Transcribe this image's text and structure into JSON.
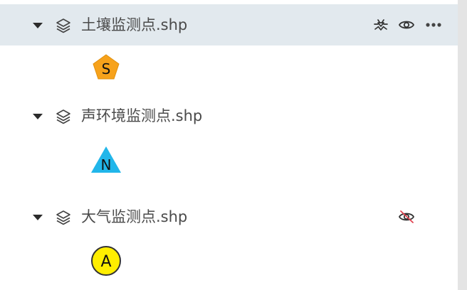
{
  "layers": [
    {
      "name": "土壤监测点.shp",
      "selected": true,
      "visible": true,
      "actions": [
        "bug-icon",
        "eye-icon",
        "more-icon"
      ],
      "symbol": {
        "shape": "pentagon",
        "letter": "S",
        "color": "#f7a21b"
      }
    },
    {
      "name": "声环境监测点.shp",
      "selected": false,
      "visible": true,
      "actions": [],
      "symbol": {
        "shape": "triangle",
        "letter": "N",
        "color": "#21b6ea"
      }
    },
    {
      "name": "大气监测点.shp",
      "selected": false,
      "visible": false,
      "actions": [
        "eye-off-icon"
      ],
      "symbol": {
        "shape": "circle",
        "letter": "A",
        "color": "#ffee00"
      }
    }
  ]
}
